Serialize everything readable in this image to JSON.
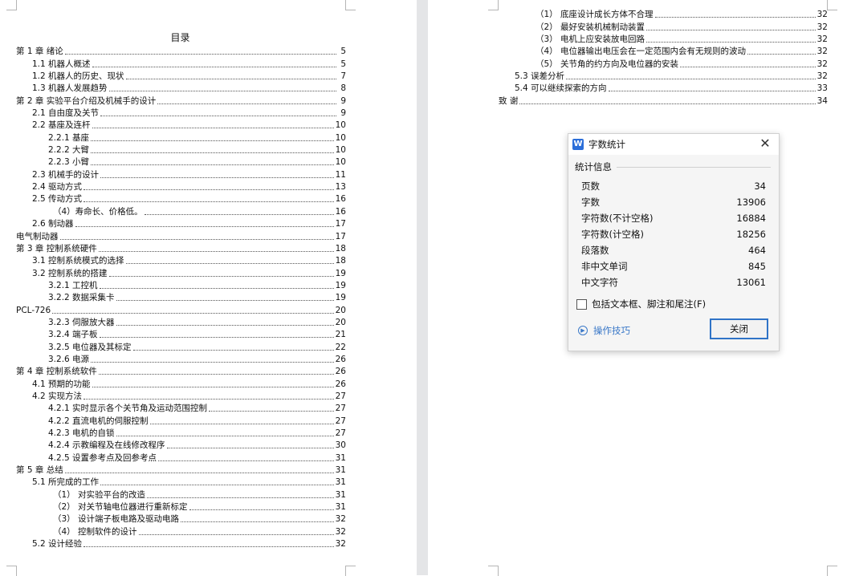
{
  "toc_title": "目录",
  "left_toc": [
    {
      "title": "第 1 章 绪论",
      "page": "5",
      "level": 0
    },
    {
      "title": "1.1 机器人概述",
      "page": "5",
      "level": 1
    },
    {
      "title": "1.2 机器人的历史、现状",
      "page": "7",
      "level": 1
    },
    {
      "title": "1.3 机器人发展趋势",
      "page": "8",
      "level": 1
    },
    {
      "title": "第 2 章 实验平台介绍及机械手的设计",
      "page": "9",
      "level": 0
    },
    {
      "title": "2.1 自由度及关节",
      "page": "9",
      "level": 1
    },
    {
      "title": "2.2 基座及连杆",
      "page": "10",
      "level": 1
    },
    {
      "title": "2.2.1 基座",
      "page": "10",
      "level": 2
    },
    {
      "title": "2.2.2 大臂",
      "page": "10",
      "level": 2
    },
    {
      "title": "2.2.3 小臂",
      "page": "10",
      "level": 2
    },
    {
      "title": "2.3 机械手的设计",
      "page": "11",
      "level": 1
    },
    {
      "title": "2.4 驱动方式",
      "page": "13",
      "level": 1
    },
    {
      "title": "2.5 传动方式",
      "page": "16",
      "level": 1
    },
    {
      "title": "（4）寿命长、价格低。",
      "page": "16",
      "level": 3
    },
    {
      "title": "2.6 制动器",
      "page": "17",
      "level": 1
    },
    {
      "title": "电气制动器",
      "page": "17",
      "level": 0
    },
    {
      "title": "第 3 章 控制系统硬件",
      "page": "18",
      "level": 0
    },
    {
      "title": "3.1 控制系统模式的选择",
      "page": "18",
      "level": 1
    },
    {
      "title": "3.2 控制系统的搭建",
      "page": "19",
      "level": 1
    },
    {
      "title": "3.2.1 工控机",
      "page": "19",
      "level": 2
    },
    {
      "title": "3.2.2 数据采集卡",
      "page": "19",
      "level": 2
    },
    {
      "title": "PCL-726",
      "page": "20",
      "level": 0
    },
    {
      "title": "3.2.3 伺服放大器",
      "page": "20",
      "level": 2
    },
    {
      "title": "3.2.4 端子板",
      "page": "21",
      "level": 2
    },
    {
      "title": "3.2.5 电位器及其标定",
      "page": "22",
      "level": 2
    },
    {
      "title": "3.2.6 电源",
      "page": "26",
      "level": 2
    },
    {
      "title": "第 4 章 控制系统软件",
      "page": "26",
      "level": 0
    },
    {
      "title": "4.1 预期的功能",
      "page": "26",
      "level": 1
    },
    {
      "title": "4.2 实现方法",
      "page": "27",
      "level": 1
    },
    {
      "title": "4.2.1 实时显示各个关节角及运动范围控制",
      "page": "27",
      "level": 2
    },
    {
      "title": "4.2.2 直流电机的伺服控制",
      "page": "27",
      "level": 2
    },
    {
      "title": "4.2.3 电机的自锁",
      "page": "27",
      "level": 2
    },
    {
      "title": "4.2.4 示教编程及在线修改程序",
      "page": "30",
      "level": 2
    },
    {
      "title": "4.2.5 设置参考点及回参考点",
      "page": "31",
      "level": 2
    },
    {
      "title": "第 5 章 总结",
      "page": "31",
      "level": 0
    },
    {
      "title": "5.1 所完成的工作",
      "page": "31",
      "level": 1
    },
    {
      "title": "（1） 对实验平台的改造",
      "page": "31",
      "level": 3
    },
    {
      "title": "（2） 对关节轴电位器进行重新标定",
      "page": "31",
      "level": 3
    },
    {
      "title": "（3） 设计端子板电路及驱动电路",
      "page": "32",
      "level": 3
    },
    {
      "title": "（4） 控制软件的设计",
      "page": "32",
      "level": 3
    },
    {
      "title": "5.2 设计经验",
      "page": "32",
      "level": 1
    }
  ],
  "right_toc": [
    {
      "title": "（1） 底座设计成长方体不合理",
      "page": "32",
      "level": 3
    },
    {
      "title": "（2） 最好安装机械制动装置",
      "page": "32",
      "level": 3
    },
    {
      "title": "（3） 电机上应安装放电回路",
      "page": "32",
      "level": 3
    },
    {
      "title": "（4） 电位器输出电压会在一定范围内会有无规则的波动",
      "page": "32",
      "level": 3
    },
    {
      "title": "（5） 关节角的约方向及电位器的安装",
      "page": "32",
      "level": 3
    },
    {
      "title": "5.3 误差分析",
      "page": "32",
      "level": 1
    },
    {
      "title": "5.4 可以继续探索的方向",
      "page": "33",
      "level": 1
    },
    {
      "title": "致 谢",
      "page": "34",
      "level": 0
    }
  ],
  "dialog": {
    "app_icon": "W",
    "title": "字数统计",
    "section_label": "统计信息",
    "stats": [
      {
        "label": "页数",
        "value": "34"
      },
      {
        "label": "字数",
        "value": "13906"
      },
      {
        "label": "字符数(不计空格)",
        "value": "16884"
      },
      {
        "label": "字符数(计空格)",
        "value": "18256"
      },
      {
        "label": "段落数",
        "value": "464"
      },
      {
        "label": "非中文单词",
        "value": "845"
      },
      {
        "label": "中文字符",
        "value": "13061"
      }
    ],
    "checkbox_label": "包括文本框、脚注和尾注(F)",
    "checkbox_checked": false,
    "tips_label": "操作技巧",
    "close_label": "关闭",
    "close_symbol": "✕"
  }
}
